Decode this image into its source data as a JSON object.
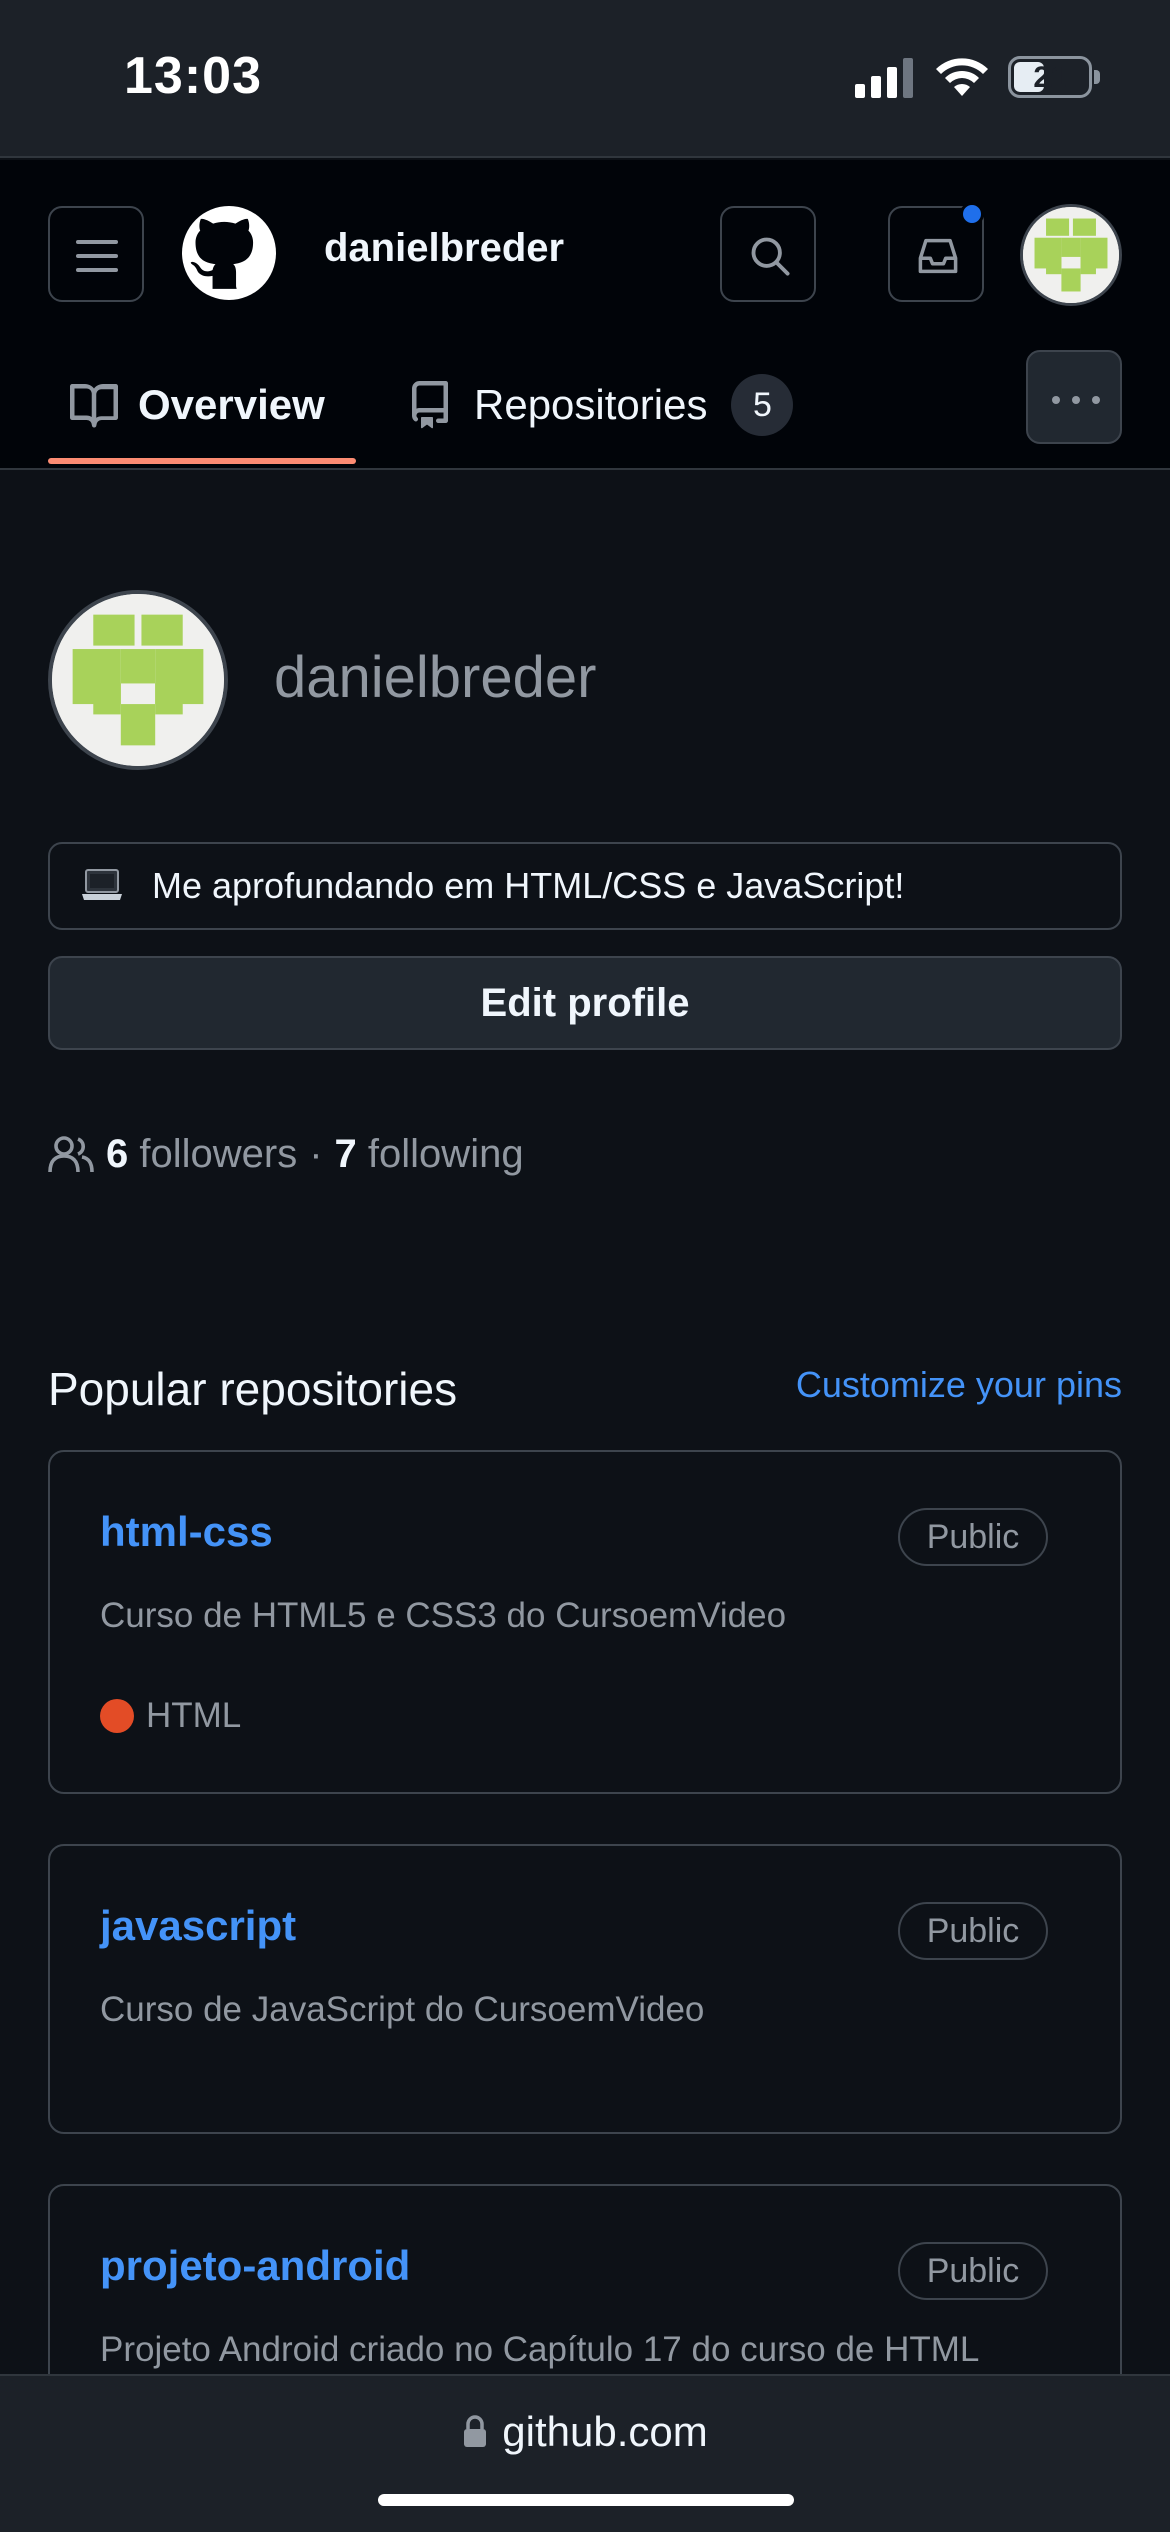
{
  "status_bar": {
    "time": "13:03",
    "battery": "21"
  },
  "header": {
    "username": "danielbreder",
    "icons": [
      "menu-icon",
      "github-logo-icon",
      "search-icon",
      "inbox-icon",
      "avatar"
    ],
    "notification_dot_color": "#1f6feb"
  },
  "tabs": [
    {
      "label": "Overview",
      "icon": "book-icon",
      "selected": true
    },
    {
      "label": "Repositories",
      "icon": "repo-icon",
      "count": "5"
    }
  ],
  "profile": {
    "name": "danielbreder",
    "status_emoji": "laptop-icon",
    "status_text": "Me aprofundando em HTML/CSS e JavaScript!",
    "edit_button": "Edit profile",
    "followers_count": "6",
    "followers_label": "followers",
    "separator": "·",
    "following_count": "7",
    "following_label": "following"
  },
  "popular": {
    "title": "Popular repositories",
    "customize_link": "Customize your pins",
    "repos": [
      {
        "name": "html-css",
        "visibility": "Public",
        "description": "Curso de HTML5 e CSS3 do CursoemVideo",
        "language": "HTML",
        "language_color": "#e34c26"
      },
      {
        "name": "javascript",
        "visibility": "Public",
        "description": "Curso de JavaScript do CursoemVideo"
      },
      {
        "name": "projeto-android",
        "visibility": "Public",
        "description": "Projeto Android criado no Capítulo 17 do curso de HTML"
      }
    ]
  },
  "url_bar": {
    "url": "github.com"
  },
  "colors": {
    "background": "#0d1117",
    "link": "#4493f8",
    "tab_underline": "#fd8c73",
    "avatar_green": "#a8d25a"
  }
}
